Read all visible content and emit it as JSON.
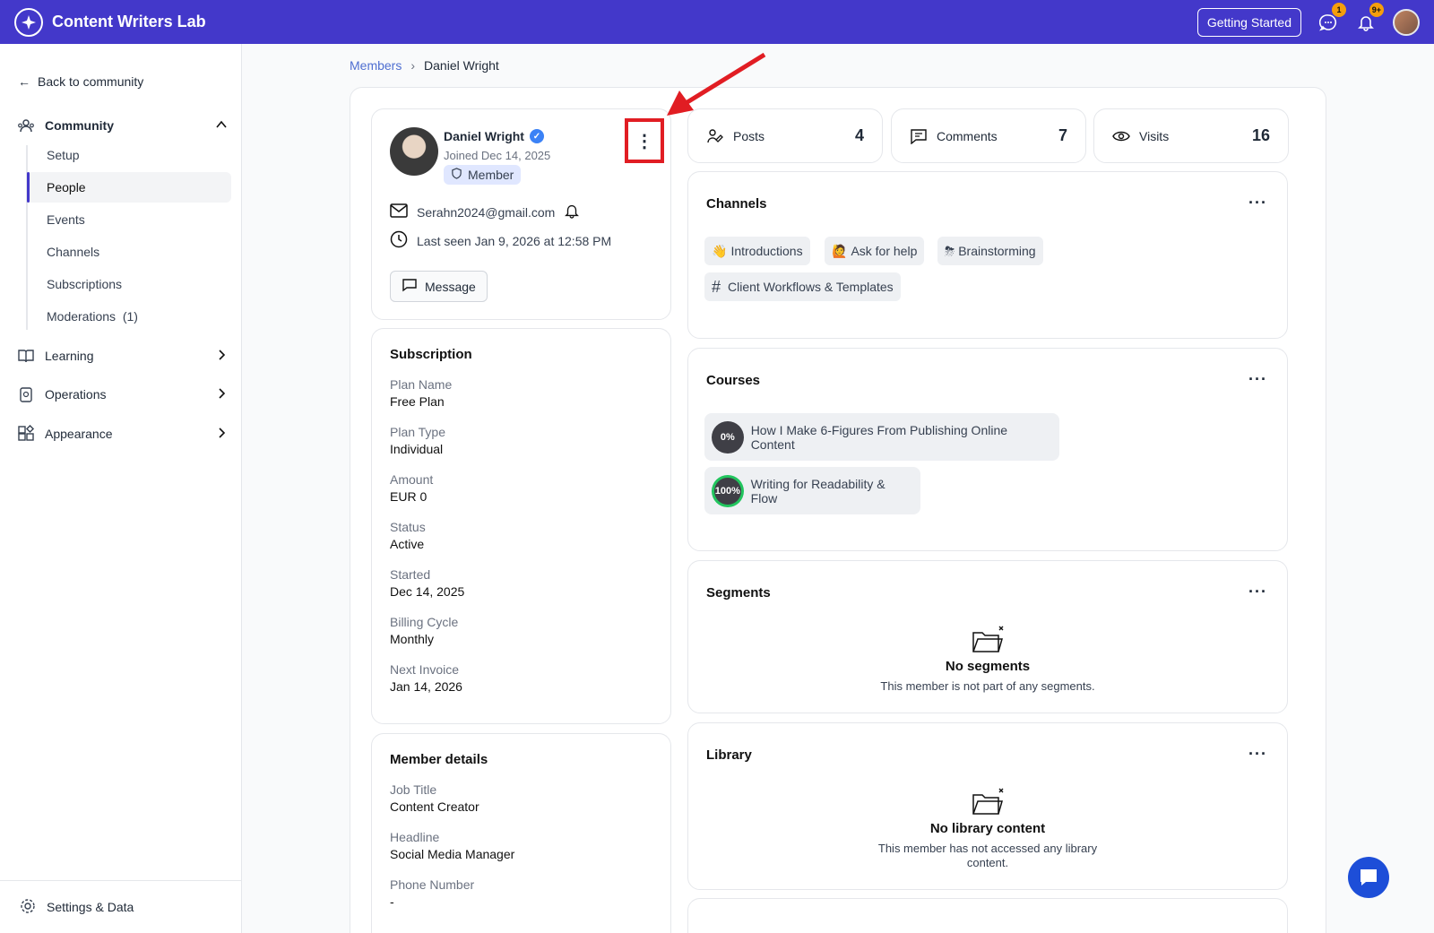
{
  "app": {
    "name": "Content Writers Lab"
  },
  "topbar": {
    "getting_started": "Getting Started",
    "chat_badge": "1",
    "notif_badge": "9+"
  },
  "sidebar": {
    "back": "Back to community",
    "community": {
      "label": "Community",
      "items": [
        {
          "label": "Setup"
        },
        {
          "label": "People",
          "active": true
        },
        {
          "label": "Events"
        },
        {
          "label": "Channels"
        },
        {
          "label": "Subscriptions"
        },
        {
          "label": "Moderations",
          "count": "(1)"
        }
      ]
    },
    "groups": [
      {
        "label": "Learning",
        "icon": "book-icon"
      },
      {
        "label": "Operations",
        "icon": "clipboard-icon"
      },
      {
        "label": "Appearance",
        "icon": "layout-icon"
      }
    ],
    "settings": "Settings & Data"
  },
  "breadcrumb": {
    "root": "Members",
    "current": "Daniel Wright"
  },
  "profile": {
    "name": "Daniel Wright",
    "joined": "Joined Dec 14, 2025",
    "role": "Member",
    "email": "Serahn2024@gmail.com",
    "last_seen": "Last seen Jan 9, 2026 at 12:58 PM",
    "message": "Message"
  },
  "subscription": {
    "title": "Subscription",
    "fields": [
      {
        "label": "Plan Name",
        "value": "Free Plan"
      },
      {
        "label": "Plan Type",
        "value": "Individual"
      },
      {
        "label": "Amount",
        "value": "EUR 0"
      },
      {
        "label": "Status",
        "value": "Active"
      },
      {
        "label": "Started",
        "value": "Dec 14, 2025"
      },
      {
        "label": "Billing Cycle",
        "value": "Monthly"
      },
      {
        "label": "Next Invoice",
        "value": "Jan 14, 2026"
      }
    ]
  },
  "member_details": {
    "title": "Member details",
    "fields": [
      {
        "label": "Job Title",
        "value": "Content Creator"
      },
      {
        "label": "Headline",
        "value": "Social Media Manager"
      },
      {
        "label": "Phone Number",
        "value": "-"
      }
    ]
  },
  "stats": [
    {
      "label": "Posts",
      "value": "4"
    },
    {
      "label": "Comments",
      "value": "7"
    },
    {
      "label": "Visits",
      "value": "16"
    }
  ],
  "channels": {
    "title": "Channels",
    "items": [
      {
        "emoji": "👋",
        "label": "Introductions"
      },
      {
        "emoji": "🙋",
        "label": "Ask for help"
      },
      {
        "emoji": "⛈",
        "label": "Brainstorming"
      },
      {
        "emoji": "#",
        "label": "Client Workflows & Templates"
      }
    ]
  },
  "courses": {
    "title": "Courses",
    "items": [
      {
        "progress": "0%",
        "title": "How I Make 6-Figures From Publishing Online Content"
      },
      {
        "progress": "100%",
        "title": "Writing for Readability & Flow"
      }
    ]
  },
  "segments": {
    "title": "Segments",
    "empty_title": "No segments",
    "empty_desc": "This member is not part of any segments."
  },
  "library": {
    "title": "Library",
    "empty_title": "No library content",
    "empty_desc": "This member has not accessed any library content."
  },
  "colors": {
    "brand": "#4338ca",
    "highlight": "#e11d23",
    "verified": "#3b82f6"
  }
}
